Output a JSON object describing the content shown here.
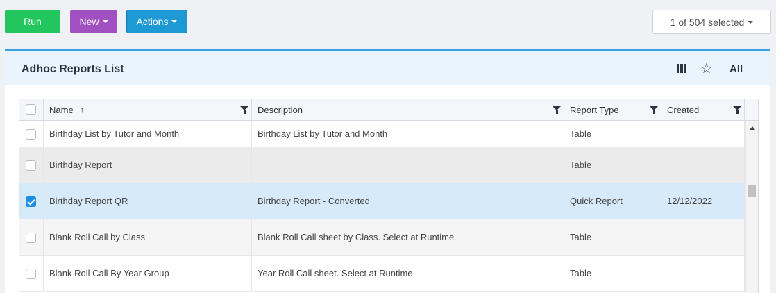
{
  "toolbar": {
    "run_label": "Run",
    "new_label": "New",
    "actions_label": "Actions",
    "selected_label": "1 of 504 selected"
  },
  "panel": {
    "title": "Adhoc Reports List",
    "all_label": "All",
    "icons": [
      "columns-icon",
      "star-icon"
    ]
  },
  "table": {
    "columns": {
      "name": "Name",
      "description": "Description",
      "report_type": "Report Type",
      "created": "Created"
    },
    "sort_indicator": "↑",
    "rows": [
      {
        "name": "Birthday List by Tutor and Month",
        "description": "Birthday List by Tutor and Month",
        "report_type": "Table",
        "created": "",
        "checked": false
      },
      {
        "name": "Birthday Report",
        "description": "",
        "report_type": "Table",
        "created": "",
        "checked": false
      },
      {
        "name": "Birthday Report QR",
        "description": "Birthday Report - Converted",
        "report_type": "Quick Report",
        "created": "12/12/2022",
        "checked": true
      },
      {
        "name": "Blank Roll Call by Class",
        "description": "Blank Roll Call sheet by Class. Select at Runtime",
        "report_type": "Table",
        "created": "",
        "checked": false
      },
      {
        "name": "Blank Roll Call By Year Group",
        "description": "Year Roll Call sheet. Select at Runtime",
        "report_type": "Table",
        "created": "",
        "checked": false
      }
    ]
  },
  "colors": {
    "run": "#22c55e",
    "new": "#a050c0",
    "actions": "#1d9ad6",
    "selected_row": "#d6eafa",
    "hover_row": "#ebebeb"
  }
}
